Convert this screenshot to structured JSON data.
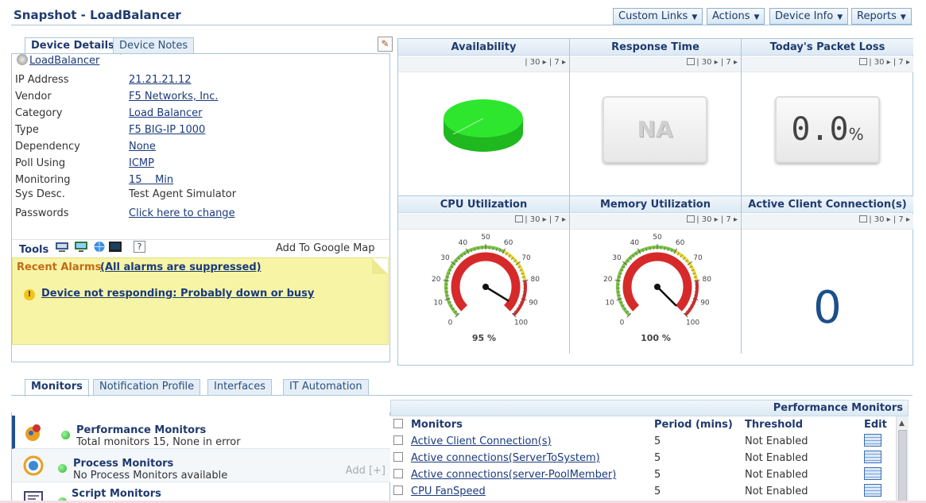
{
  "header": {
    "title": "Snapshot - LoadBalancer",
    "buttons": [
      "Custom Links",
      "Actions",
      "Device Info",
      "Reports"
    ]
  },
  "device_panel": {
    "tabs": [
      "Device Details",
      "Device Notes"
    ],
    "device_name": "LoadBalancer",
    "properties": [
      {
        "label": "IP Address",
        "value": "21.21.21.12",
        "link": true
      },
      {
        "label": "Vendor",
        "value": "F5 Networks, Inc.",
        "link": true
      },
      {
        "label": "Category",
        "value": "Load Balancer",
        "link": true
      },
      {
        "label": "Type",
        "value": "F5 BIG-IP 1000",
        "link": true
      },
      {
        "label": "Dependency",
        "value": "None",
        "link": true
      },
      {
        "label": "Poll Using",
        "value": "ICMP",
        "link": true
      },
      {
        "label": "Monitoring",
        "value": "15    Min",
        "link": true
      },
      {
        "label": "Sys Desc.",
        "value": "Test Agent Simulator",
        "link": false
      },
      {
        "label": "Passwords",
        "value": "Click here to change",
        "link": true
      }
    ],
    "tools_label": "Tools",
    "tool_icons": [
      "telnet-icon",
      "monitor-icon",
      "globe-icon",
      "terminal-icon",
      "help-icon"
    ],
    "help_glyph": "?",
    "google_map": "Add To Google Map"
  },
  "alarms": {
    "title": "Recent Alarms",
    "suppressed": "(All alarms are suppressed)",
    "items": [
      "Device not responding: Probably down or busy"
    ],
    "warn_glyph": "!"
  },
  "metrics": {
    "availability": {
      "title": "Availability",
      "bar": "| 30 ▸ | 7 ▸"
    },
    "response_time": {
      "title": "Response Time",
      "bar": "| 30 ▸ | 7 ▸",
      "value": "NA"
    },
    "packet_loss": {
      "title": "Today's Packet Loss",
      "bar": "| 30 ▸ | 7 ▸",
      "value": "0.0",
      "unit": "%"
    },
    "cpu": {
      "title": "CPU Utilization",
      "bar": "| 30 ▸ | 7 ▸",
      "value": 95,
      "label": "95 %"
    },
    "memory": {
      "title": "Memory Utilization",
      "bar": "| 30 ▸ | 7 ▸",
      "value": 100,
      "label": "100 %"
    },
    "connections": {
      "title": "Active Client Connection(s)",
      "bar": "| 30 ▸ | 7 ▸",
      "value": "0"
    },
    "gauge_ticks": [
      "0",
      "10",
      "20",
      "30",
      "40",
      "50",
      "60",
      "70",
      "80",
      "90",
      "100"
    ],
    "availability_percent": 100
  },
  "bottom_tabs": [
    "Monitors",
    "Notification Profile",
    "Interfaces",
    "IT Automation"
  ],
  "monitor_list": [
    {
      "name": "Performance Monitors",
      "desc": "Total monitors 15, None in error",
      "add": ""
    },
    {
      "name": "Process Monitors",
      "desc": "No Process Monitors available",
      "add": "Add [+]"
    },
    {
      "name": "Script Monitors",
      "desc": "",
      "add": ""
    }
  ],
  "perf_table": {
    "heading": "Performance Monitors",
    "columns": [
      "Monitors",
      "Period (mins)",
      "Threshold",
      "Edit"
    ],
    "rows": [
      {
        "monitor": "Active Client Connection(s)",
        "period": "5",
        "threshold": "Not Enabled"
      },
      {
        "monitor": "Active connections(ServerToSystem)",
        "period": "5",
        "threshold": "Not Enabled"
      },
      {
        "monitor": "Active connections(server-PoolMember)",
        "period": "5",
        "threshold": "Not Enabled"
      },
      {
        "monitor": "CPU FanSpeed",
        "period": "5",
        "threshold": "Not Enabled"
      }
    ]
  },
  "colors": {
    "accent": "#1f3a6e",
    "link": "#1a3a7c",
    "alarm_bg": "#f7f5a5",
    "available": "#2ee62e",
    "gauge_red": "#d62a2a",
    "connections": "#1b4f8a"
  }
}
